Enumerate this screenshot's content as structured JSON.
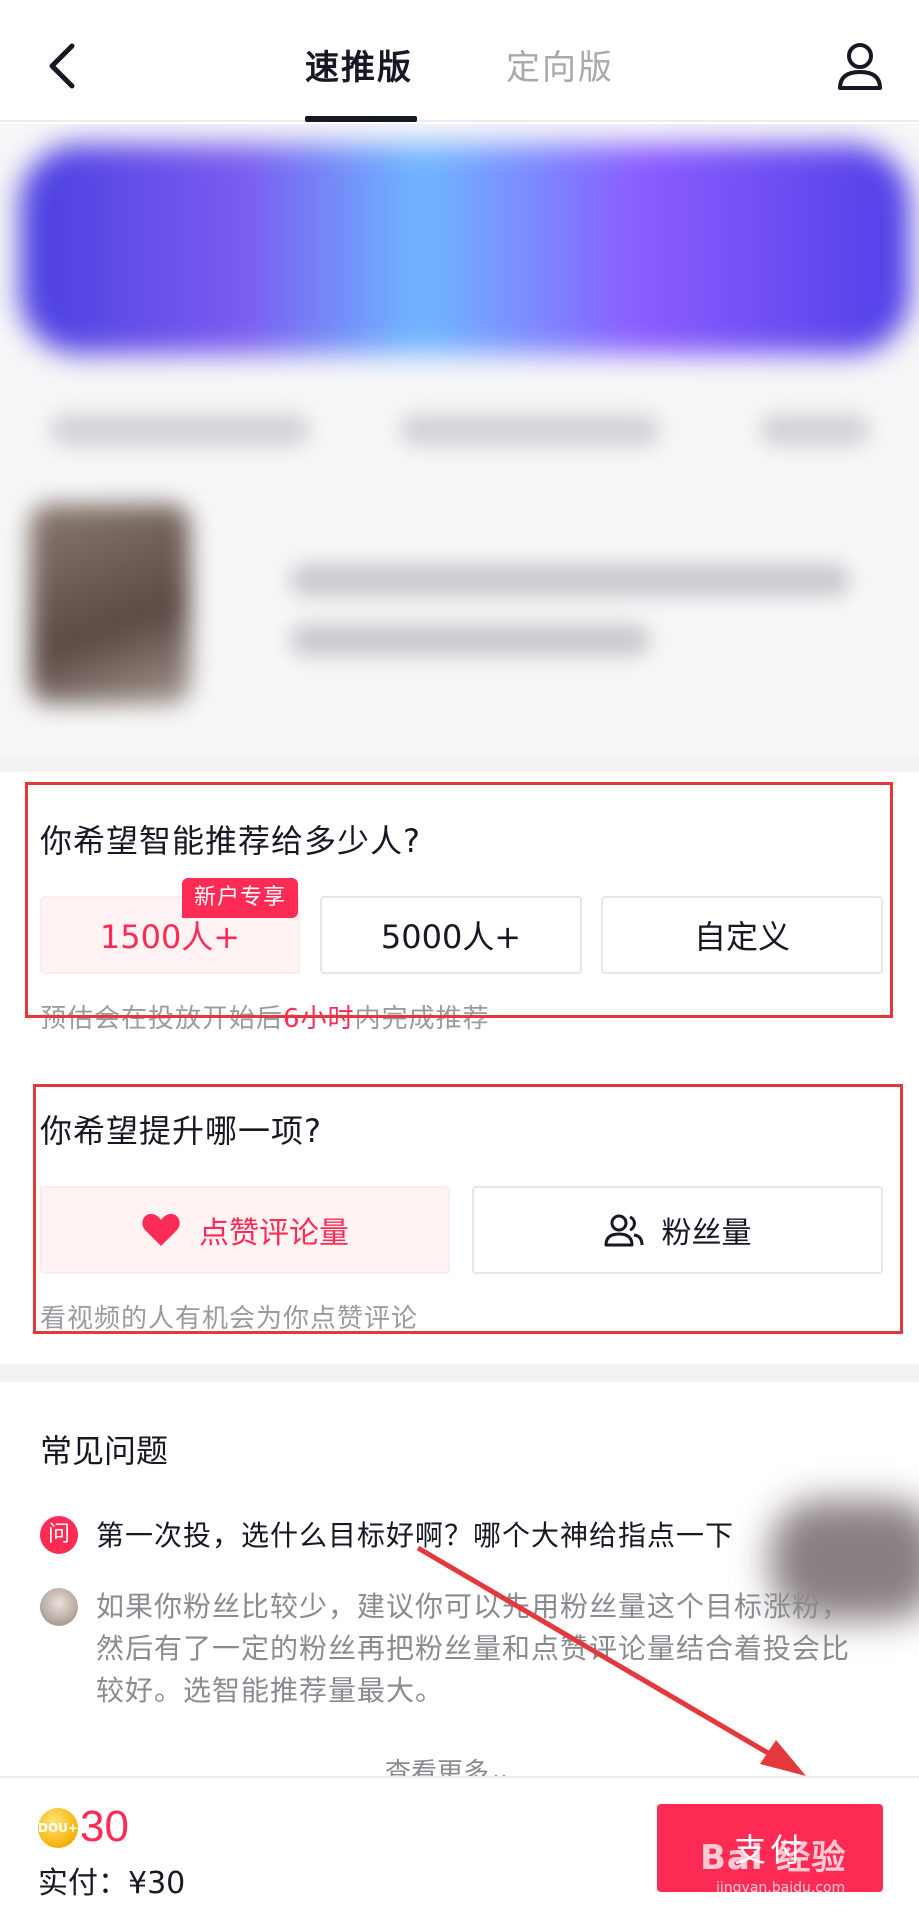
{
  "header": {
    "tabs": [
      {
        "label": "速推版",
        "active": true
      },
      {
        "label": "定向版",
        "active": false
      }
    ]
  },
  "audience": {
    "question": "你希望智能推荐给多少人?",
    "badge": "新户专享",
    "options": [
      "1500人+",
      "5000人+",
      "自定义"
    ],
    "selected": "1500人+",
    "hint_pre": "预估会在投放开始后",
    "hint_highlight": "6小时",
    "hint_post": "内完成推荐"
  },
  "goal": {
    "question": "你希望提升哪一项?",
    "options": [
      {
        "label": "点赞评论量",
        "icon": "heart-icon",
        "selected": true
      },
      {
        "label": "粉丝量",
        "icon": "users-icon",
        "selected": false
      }
    ],
    "hint": "看视频的人有机会为你点赞评论"
  },
  "faq": {
    "title": "常见问题",
    "question_icon": "问",
    "question": "第一次投，选什么目标好啊？哪个大神给指点一下",
    "answer": "如果你粉丝比较少，建议你可以先用粉丝量这个目标涨粉，然后有了一定的粉丝再把粉丝量和点赞评论量结合着投会比较好。选智能推荐量最大。",
    "see_more": "查看更多"
  },
  "footer": {
    "coin_amount": "30",
    "paid_label": "实付：",
    "paid_value": "¥30",
    "pay_button": "支付"
  },
  "watermark": {
    "text": "Bai 经验",
    "sub": "jingyan.baidu.com"
  },
  "colors": {
    "accent": "#fe2c55",
    "annotation": "#e4393c"
  }
}
